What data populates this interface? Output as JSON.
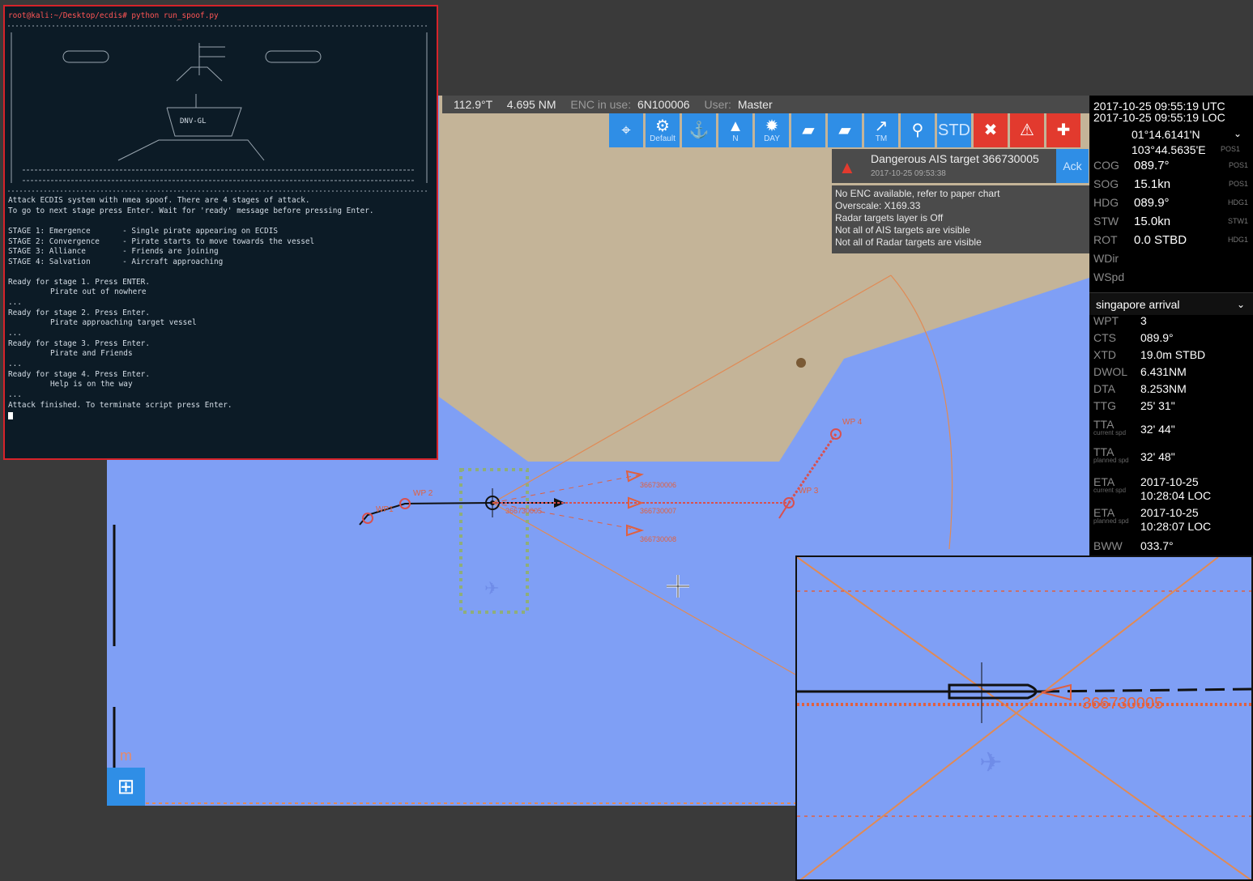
{
  "terminal": {
    "title": "root@kali:~/Desktop/ecdis# python run_spoof.py",
    "ship_label": "DNV-GL",
    "intro": [
      "Attack ECDIS system with nmea spoof. There are 4 stages of attack.",
      "To go to next stage press Enter. Wait for 'ready' message before pressing Enter."
    ],
    "stages": [
      "STAGE 1: Emergence       - Single pirate appearing on ECDIS",
      "STAGE 2: Convergence     - Pirate starts to move towards the vessel",
      "STAGE 3: Alliance        - Friends are joining",
      "STAGE 4: Salvation       - Aircraft approaching"
    ],
    "log": [
      {
        "text": "Ready for stage 1. Press ENTER.",
        "indent": false
      },
      {
        "text": "Pirate out of nowhere",
        "indent": true
      },
      {
        "text": "...",
        "indent": false
      },
      {
        "text": "Ready for stage 2. Press Enter.",
        "indent": false
      },
      {
        "text": "Pirate approaching target vessel",
        "indent": true
      },
      {
        "text": "...",
        "indent": false
      },
      {
        "text": "Ready for stage 3. Press Enter.",
        "indent": false
      },
      {
        "text": "Pirate and Friends",
        "indent": true
      },
      {
        "text": "...",
        "indent": false
      },
      {
        "text": "Ready for stage 4. Press Enter.",
        "indent": false
      },
      {
        "text": "Help is on the way",
        "indent": true
      },
      {
        "text": "...",
        "indent": false
      },
      {
        "text": "Attack finished. To terminate script press Enter.",
        "indent": false
      }
    ]
  },
  "status": {
    "bearing": "112.9°T",
    "distance": "4.695 NM",
    "enc_label": "ENC in use:",
    "enc_value": "6N100006",
    "user_label": "User:",
    "user_value": "Master"
  },
  "toolbar": [
    {
      "icon": "target-icon",
      "glyph": "⌖",
      "label": ""
    },
    {
      "icon": "gear-icon",
      "glyph": "⚙",
      "label": "Default"
    },
    {
      "icon": "anchor-icon",
      "glyph": "⚓",
      "label": ""
    },
    {
      "icon": "north-arrow-icon",
      "glyph": "▲",
      "label": "N"
    },
    {
      "icon": "sun-icon",
      "glyph": "✹",
      "label": "DAY"
    },
    {
      "icon": "ruler-icon",
      "glyph": "▰",
      "label": ""
    },
    {
      "icon": "ruler-icon-2",
      "glyph": "▰",
      "label": ""
    },
    {
      "icon": "trial-maneuver-icon",
      "glyph": "↗",
      "label": "TM"
    },
    {
      "icon": "pin-icon",
      "glyph": "⚲",
      "label": ""
    },
    {
      "icon": "std-icon",
      "glyph": "STD",
      "label": ""
    },
    {
      "icon": "close-icon",
      "glyph": "✖",
      "label": ""
    },
    {
      "icon": "warning-icon",
      "glyph": "⚠",
      "label": ""
    },
    {
      "icon": "lifebuoy-icon",
      "glyph": "✚",
      "label": ""
    }
  ],
  "alert": {
    "message": "Dangerous AIS target 366730005",
    "time": "2017-10-25 09:53:38",
    "ack_label": "Ack"
  },
  "warnings": [
    "No ENC available, refer to paper chart",
    "Overscale: X169.33",
    "Radar targets layer is Off",
    "Not all of AIS targets are visible",
    "Not all of Radar targets are visible"
  ],
  "panel": {
    "utc": "2017-10-25 09:55:19 UTC",
    "loc": "2017-10-25 09:55:19 LOC",
    "lat": "01°14.6141'N",
    "lon": "103°44.5635'E",
    "pos_src": "POS1",
    "nav": [
      {
        "k": "COG",
        "v": "089.7°",
        "s": "POS1"
      },
      {
        "k": "SOG",
        "v": "15.1kn",
        "s": "POS1"
      },
      {
        "k": "HDG",
        "v": "089.9°",
        "s": "HDG1"
      },
      {
        "k": "STW",
        "v": "15.0kn",
        "s": "STW1"
      },
      {
        "k": "ROT",
        "v": "0.0 STBD",
        "s": "HDG1"
      },
      {
        "k": "WDir",
        "v": "",
        "s": ""
      },
      {
        "k": "WSpd",
        "v": "",
        "s": ""
      }
    ],
    "route_name": "singapore arrival",
    "route": [
      {
        "k": "WPT",
        "sub": "",
        "v": "3"
      },
      {
        "k": "CTS",
        "sub": "",
        "v": "089.9°"
      },
      {
        "k": "XTD",
        "sub": "",
        "v": "19.0m STBD"
      },
      {
        "k": "DWOL",
        "sub": "",
        "v": "6.431NM"
      },
      {
        "k": "DTA",
        "sub": "",
        "v": "8.253NM"
      },
      {
        "k": "TTG",
        "sub": "",
        "v": "25' 31\""
      },
      {
        "k": "TTA",
        "sub": "current spd",
        "v": "32' 44\""
      },
      {
        "k": "TTA",
        "sub": "planned spd",
        "v": "32' 48\""
      },
      {
        "k": "ETA",
        "sub": "current spd",
        "v": "2017-10-25",
        "v_2": "10:28:04 LOC"
      },
      {
        "k": "ETA",
        "sub": "planned spd",
        "v": "2017-10-25",
        "v_2": "10:28:07 LOC"
      },
      {
        "k": "BWW",
        "sub": "",
        "v": "033.7°"
      }
    ]
  },
  "chart_labels": {
    "target_a": "366730006",
    "target_b": "366730007",
    "target_c": "366730008",
    "own_target": "366730005",
    "wp2": "WP 2",
    "wp3": "WP 3",
    "wp4": "WP 4",
    "wp1": "WP1",
    "scale_unit": "m"
  },
  "inset_label": "366730005",
  "colors": {
    "sea": "#7f9ff5",
    "land": "#c4b498",
    "accent": "#2f8ee6",
    "alarm": "#e23a2e",
    "track": "#e8633b"
  }
}
